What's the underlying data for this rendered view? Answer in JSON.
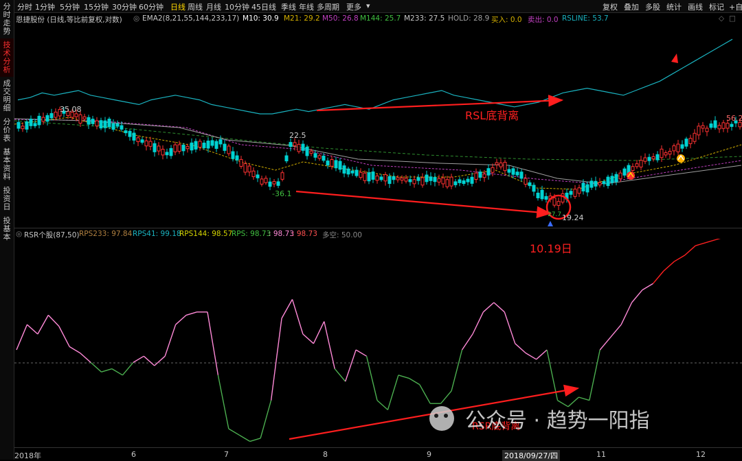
{
  "sidebar": {
    "items": [
      {
        "label": "分时走势",
        "active": false
      },
      {
        "label": "技术分析",
        "active": true
      },
      {
        "label": "成交明细",
        "active": false
      },
      {
        "label": "分价表",
        "active": false
      },
      {
        "label": "基本资料",
        "active": false
      },
      {
        "label": "投资日",
        "active": false
      },
      {
        "label": "投基本",
        "active": false
      }
    ]
  },
  "toolbar": {
    "periods": [
      "分时",
      "1分钟",
      "5分钟",
      "15分钟",
      "30分钟",
      "60分钟",
      "日线",
      "周线",
      "月线",
      "10分钟",
      "45日线",
      "季线",
      "年线",
      "多周期",
      "更多"
    ],
    "active_period": "日线",
    "right_buttons": [
      "复权",
      "叠加",
      "多股",
      "统计",
      "画线",
      "标记",
      "+自"
    ]
  },
  "main_info": {
    "stock": "恩捷股份 (日线,等比前复权,对数)",
    "indicator": "EMA2(8,21,55,144,233,17)",
    "m10": "M10: 30.9",
    "m21": "M21: 29.2",
    "m50": "M50: 26.8",
    "m144": "M144: 25.7",
    "m233": "M233: 27.5",
    "hold": "HOLD: 28.9",
    "buy": "买入: 0.0",
    "sell": "卖出: 0.0",
    "rsline": "RSLINE: 53.7"
  },
  "price_labels": {
    "high_left": "35.08",
    "mid_high": "22.5",
    "low_left": "-36.1",
    "low_right": "19.24",
    "low_right_b": "27.7",
    "right_price": "56.2"
  },
  "annotations": {
    "rsl_divergence": "RSL底背离",
    "date_note": "10.19日",
    "rsr_divergence": "RSR底背离"
  },
  "rsr_info": {
    "name": "RSR个股(87,50)",
    "rps233": "RPS233: 97.84",
    "rps41": "RPS41: 99.18",
    "rps144": "RPS144: 98.57",
    "rps": "RPS: 98.73",
    "v5": ": 98.73",
    "v6": ": 98.73",
    "duokong": "多空: 50.00"
  },
  "x_axis": [
    "2018年",
    "6",
    "7",
    "8",
    "9",
    "2018/09/27/四",
    "11",
    "12"
  ],
  "watermark": "公众号 · 趋势一阳指",
  "colors": {
    "up": "#ff3232",
    "down": "#00d2d2",
    "rsline": "#1ab3c0",
    "rsr_high": "#ff8ad8",
    "rsr_low": "#4caf50",
    "arrow": "#ff1e1e",
    "ma_yellow": "#d4b000",
    "ma_purple": "#c040c0",
    "ma_green": "#2f8f2f",
    "ma_gray": "#a0a0a0"
  },
  "chart_data": [
    {
      "type": "line",
      "title": "RSLINE",
      "series": [
        {
          "name": "RSLINE",
          "values": [
            49,
            50,
            52,
            51,
            52,
            53,
            51,
            50,
            49,
            48,
            47,
            49,
            50,
            51,
            50,
            49,
            47,
            46,
            45,
            44,
            43,
            43,
            44,
            45,
            44,
            45,
            46,
            47,
            46,
            45,
            47,
            49,
            50,
            51,
            52,
            53,
            51,
            50,
            49,
            48,
            47,
            46,
            47,
            48,
            50,
            52,
            53,
            54,
            53,
            52,
            51,
            53,
            55,
            57,
            60,
            63,
            66,
            69,
            72,
            75
          ]
        }
      ]
    },
    {
      "type": "line",
      "title": "RSR个股(87,50)",
      "ylim": [
        0,
        100
      ],
      "series": [
        {
          "name": "RSR",
          "values": [
            60,
            76,
            70,
            82,
            75,
            62,
            58,
            52,
            46,
            48,
            44,
            52,
            56,
            50,
            56,
            76,
            82,
            84,
            84,
            44,
            10,
            6,
            2,
            4,
            28,
            80,
            92,
            70,
            64,
            78,
            48,
            40,
            60,
            56,
            28,
            22,
            44,
            42,
            38,
            26,
            26,
            34,
            60,
            70,
            84,
            90,
            84,
            64,
            58,
            54,
            60,
            28,
            24,
            30,
            28,
            60,
            68,
            76,
            90,
            98,
            102,
            110,
            116,
            120,
            126,
            128,
            130,
            132,
            132
          ]
        }
      ]
    }
  ]
}
